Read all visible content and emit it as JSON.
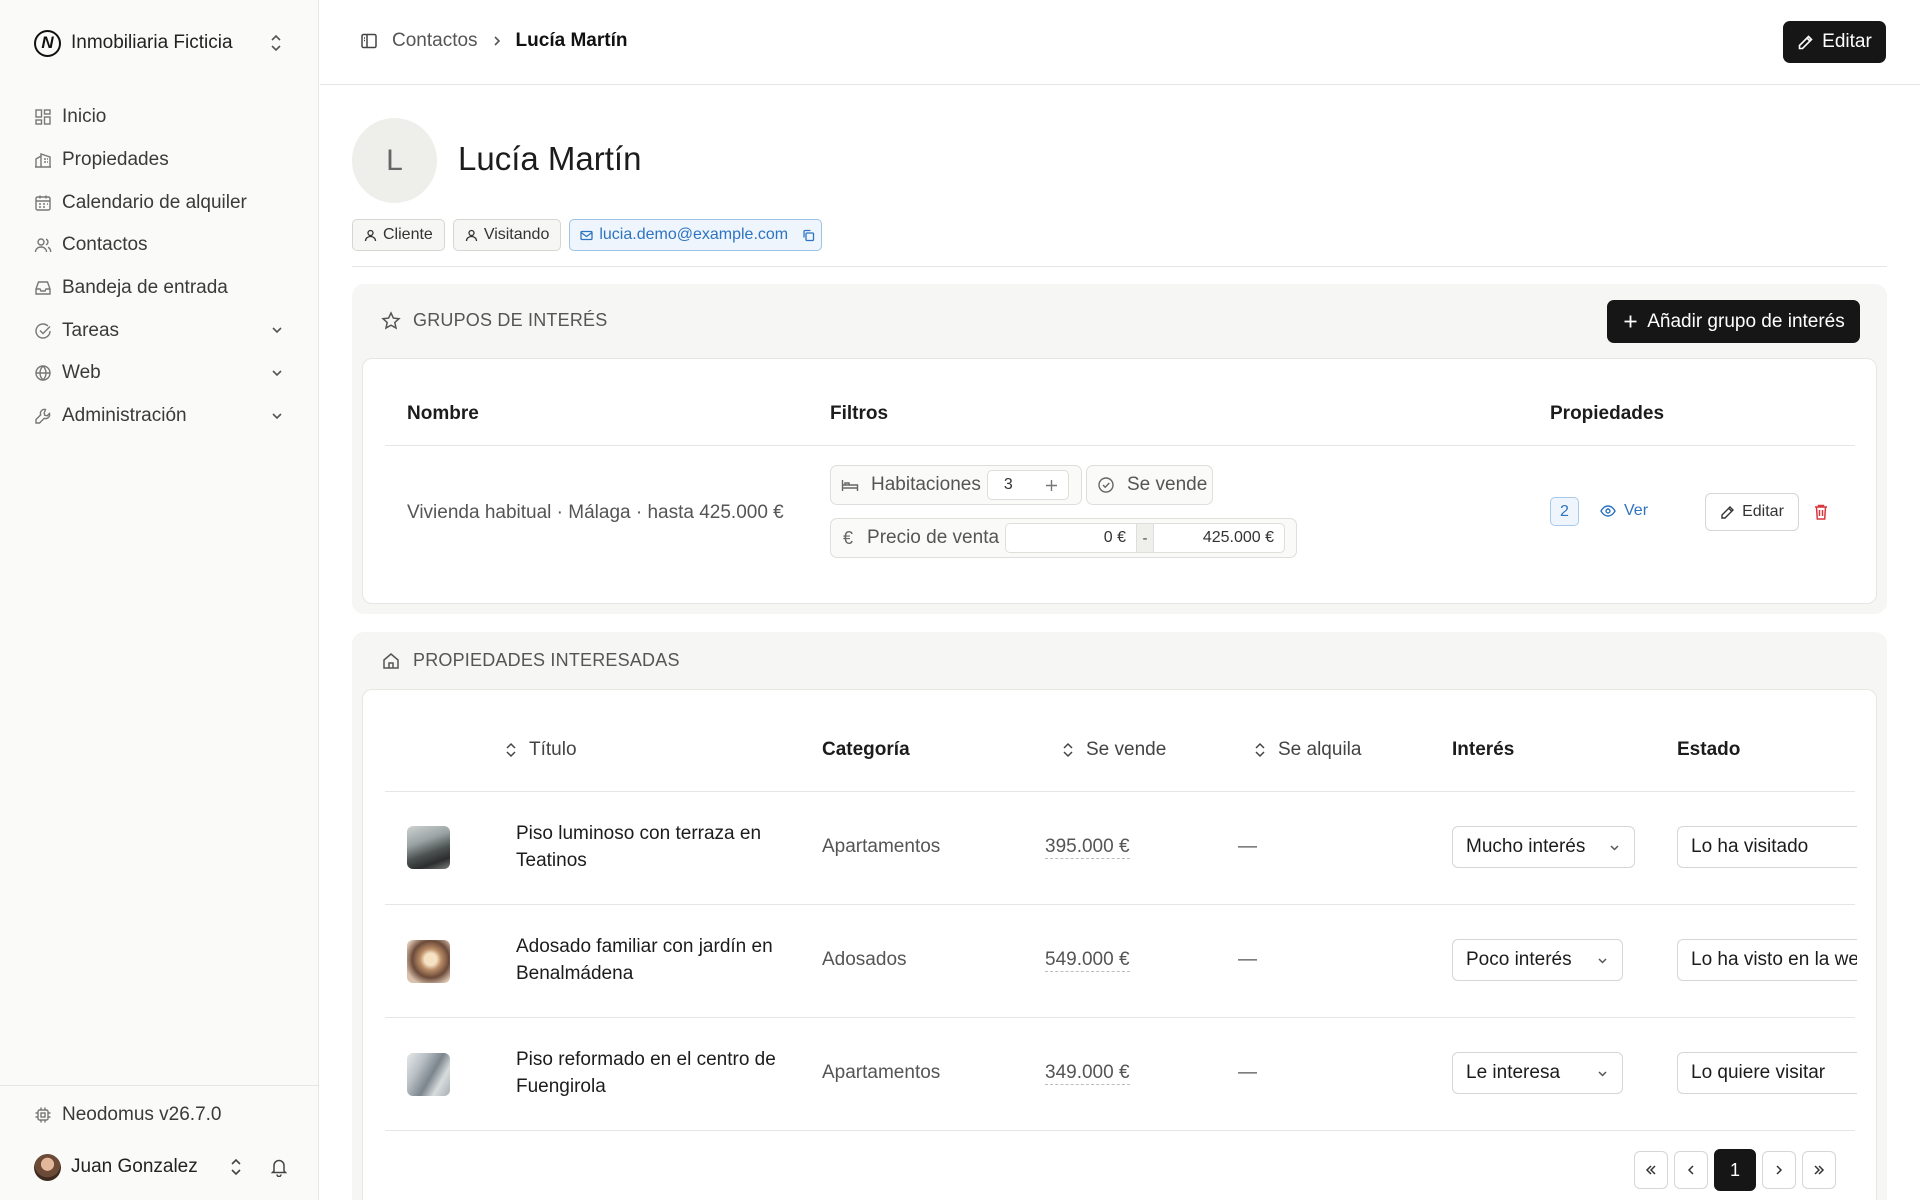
{
  "sidebar": {
    "org_name": "Inmobiliaria Ficticia",
    "org_logo_letter": "N",
    "items": [
      {
        "label": "Inicio",
        "icon": "dashboard-icon"
      },
      {
        "label": "Propiedades",
        "icon": "buildings-icon"
      },
      {
        "label": "Calendario de alquiler",
        "icon": "calendar-icon"
      },
      {
        "label": "Contactos",
        "icon": "users-icon"
      },
      {
        "label": "Bandeja de entrada",
        "icon": "inbox-icon"
      },
      {
        "label": "Tareas",
        "icon": "check-circle-icon",
        "expandable": true
      },
      {
        "label": "Web",
        "icon": "globe-icon",
        "expandable": true
      },
      {
        "label": "Administración",
        "icon": "wrench-icon",
        "expandable": true
      }
    ],
    "version": "Neodomus v26.7.0",
    "user_name": "Juan Gonzalez"
  },
  "topbar": {
    "breadcrumb_parent": "Contactos",
    "breadcrumb_current": "Lucía Martín",
    "edit_label": "Editar"
  },
  "profile": {
    "initial": "L",
    "name": "Lucía Martín",
    "tags": [
      "Cliente",
      "Visitando"
    ],
    "email": "lucia.demo@example.com"
  },
  "interest_groups": {
    "title": "GRUPOS DE INTERÉS",
    "add_label": "Añadir grupo de interés",
    "headers": {
      "name": "Nombre",
      "filters": "Filtros",
      "properties": "Propiedades"
    },
    "rows": [
      {
        "name": "Vivienda habitual · Málaga · hasta 425.000 €",
        "filter_rooms_label": "Habitaciones",
        "filter_rooms_value": "3",
        "filter_sale_label": "Se vende",
        "filter_price_label": "Precio de venta",
        "filter_price_min": "0 €",
        "filter_price_sep": "-",
        "filter_price_max": "425.000 €",
        "property_count": "2",
        "view_label": "Ver",
        "edit_label": "Editar"
      }
    ]
  },
  "interested_properties": {
    "title": "PROPIEDADES INTERESADAS",
    "headers": {
      "title": "Título",
      "category": "Categoría",
      "sale": "Se vende",
      "rent": "Se alquila",
      "interest": "Interés",
      "status": "Estado"
    },
    "rows": [
      {
        "title": "Piso luminoso con terraza en Teatinos",
        "category": "Apartamentos",
        "sale": "395.000 €",
        "rent": "—",
        "interest": "Mucho interés",
        "status": "Lo ha visitado"
      },
      {
        "title": "Adosado familiar con jardín en Benalmádena",
        "category": "Adosados",
        "sale": "549.000 €",
        "rent": "—",
        "interest": "Poco interés",
        "status": "Lo ha visto en la we"
      },
      {
        "title": "Piso reformado en el centro de Fuengirola",
        "category": "Apartamentos",
        "sale": "349.000 €",
        "rent": "—",
        "interest": "Le interesa",
        "status": "Lo quiere visitar"
      }
    ],
    "pagination": {
      "current_page": "1"
    }
  }
}
